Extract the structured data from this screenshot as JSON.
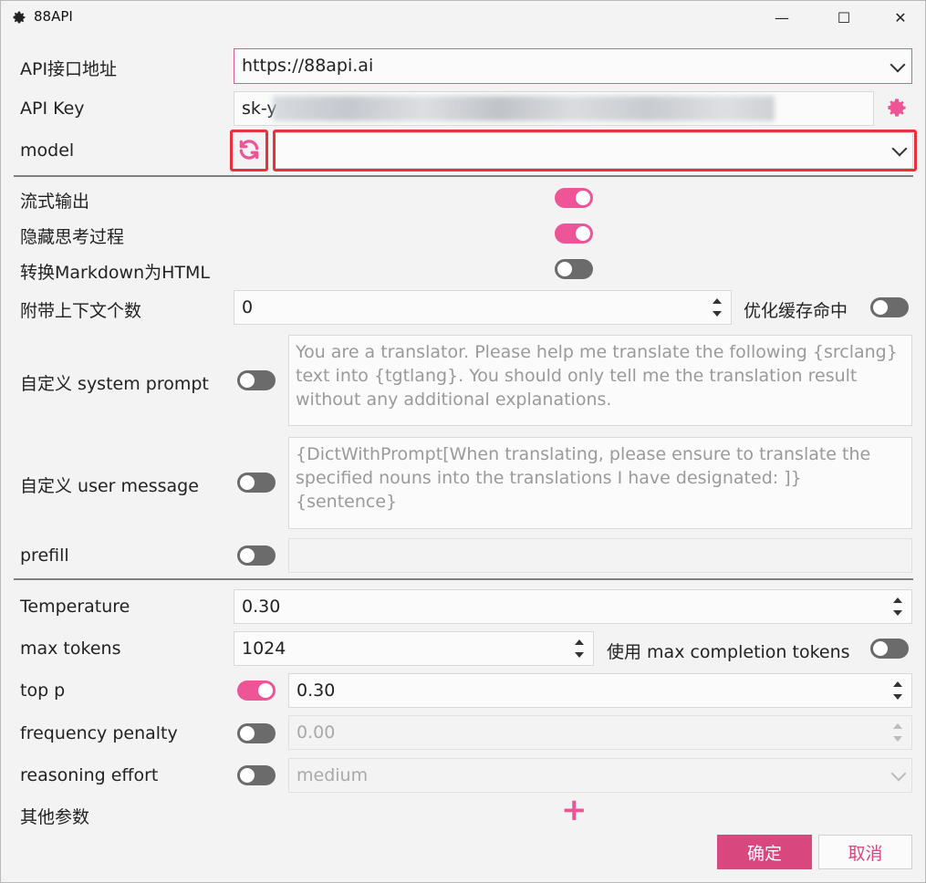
{
  "window": {
    "title": "88API",
    "minimize": "—",
    "maximize": "☐",
    "close": "✕"
  },
  "api_url": {
    "label": "API接口地址",
    "value": "https://88api.ai"
  },
  "api_key": {
    "label": "API Key",
    "value": "sk-y"
  },
  "model": {
    "label": "model",
    "value": ""
  },
  "stream_output": {
    "label": "流式输出",
    "enabled": true
  },
  "hide_thinking": {
    "label": "隐藏思考过程",
    "enabled": true
  },
  "markdown_to_html": {
    "label": "转换Markdown为HTML",
    "enabled": false
  },
  "context_count": {
    "label": "附带上下文个数",
    "value": "0",
    "cache_label": "优化缓存命中",
    "cache_enabled": false
  },
  "system_prompt": {
    "label": "自定义 system prompt",
    "enabled": false,
    "placeholder": "You are a translator. Please help me translate the following {srclang} text into {tgtlang}. You should only tell me the translation result without any additional explanations."
  },
  "user_message": {
    "label": "自定义 user message",
    "enabled": false,
    "placeholder": "{DictWithPrompt[When translating, please ensure to translate the specified nouns into the translations I have designated: ]}\n{sentence}"
  },
  "prefill": {
    "label": "prefill",
    "enabled": false,
    "value": ""
  },
  "temperature": {
    "label": "Temperature",
    "value": "0.30"
  },
  "max_tokens": {
    "label": "max tokens",
    "value": "1024",
    "completion_label": "使用 max completion tokens",
    "completion_enabled": false
  },
  "top_p": {
    "label": "top p",
    "enabled": true,
    "value": "0.30"
  },
  "frequency_penalty": {
    "label": "frequency penalty",
    "enabled": false,
    "value": "0.00"
  },
  "reasoning_effort": {
    "label": "reasoning effort",
    "enabled": false,
    "value": "medium"
  },
  "other_params": {
    "label": "其他参数",
    "add_icon": "+"
  },
  "buttons": {
    "confirm": "确定",
    "cancel": "取消"
  },
  "colors": {
    "accent": "#ee5596",
    "primary_button": "#d9477f",
    "highlight": "#e8323a"
  }
}
